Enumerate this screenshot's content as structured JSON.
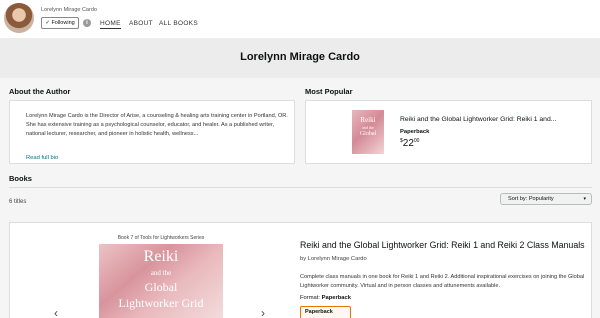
{
  "header": {
    "author_small": "Lorelynn Mirage Cardo",
    "follow_label": "✓ Following",
    "info_icon": "i",
    "nav": {
      "home": "HOME",
      "about": "ABOUT",
      "all_books": "ALL BOOKS"
    }
  },
  "hero": {
    "title": "Lorelynn Mirage Cardo"
  },
  "about": {
    "heading": "About the Author",
    "bio": "Lorelynn Mirage Cardo is the Director of Arise, a counseling & healing arts training center in Portland, OR. She has extensive training as a psychological counselor, educator, and healer. As a published writer, national lecturer, researcher, and pioneer in holistic health, wellness...",
    "read_more": "Read full bio"
  },
  "popular": {
    "heading": "Most Popular",
    "cover_word1": "Reiki",
    "cover_word2": "and the",
    "cover_word3": "Global",
    "title": "Reiki and the Global Lightworker Grid: Reiki 1 and...",
    "format": "Paperback",
    "price_currency": "$",
    "price_whole": "22",
    "price_fraction": "00"
  },
  "books": {
    "heading": "Books",
    "count": "6 titles",
    "sort_label": "Sort by: Popularity",
    "series": "Book 7 of Tools for Lightworkers Series",
    "cover_line1": "Reiki",
    "cover_line2": "and the",
    "cover_line3": "Global",
    "cover_line4": "Lightworker Grid",
    "title": "Reiki and the Global Lightworker Grid: Reiki 1 and Reiki 2 Class Manuals",
    "author": "by Lorelynn Mirage Cardo",
    "description": "Complete class manuals in one book for Reiki 1 and Reiki 2. Additional inspirational exercises on joining the Global Lightworker community. Virtual and in person classes and attunements available.",
    "format_label": "Format:",
    "format_value": "Paperback",
    "format_option": "Paperback",
    "arrow_left": "‹",
    "arrow_right": "›"
  },
  "colors": {
    "link": "#007185",
    "selected_border": "#e77600"
  }
}
